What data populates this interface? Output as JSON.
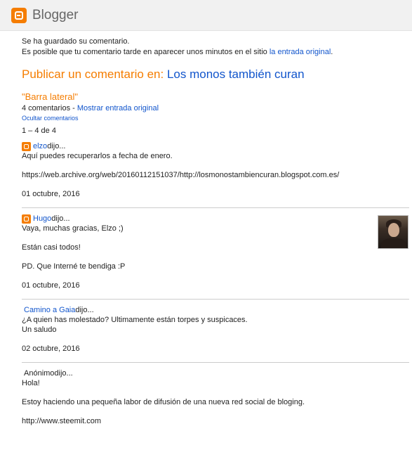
{
  "header": {
    "logo_text": "Blogger"
  },
  "notice": {
    "line1": "Se ha guardado su comentario.",
    "line2_prefix": "Es posible que tu comentario tarde en aparecer unos minutos en el sitio ",
    "line2_link": "la entrada original",
    "line2_suffix": "."
  },
  "publish": {
    "prefix": "Publicar un comentario en: ",
    "blog_name": "Los monos también curan"
  },
  "post": {
    "title": "\"Barra lateral\"",
    "comment_count": "4 comentarios",
    "separator": " - ",
    "show_post_link": "Mostrar entrada original",
    "hide_comments_link": "Ocultar comentarios",
    "range": "1 – 4 de 4"
  },
  "comments": [
    {
      "author": "elzo",
      "said": " dijo...",
      "lines": [
        "Aquí puedes recuperarlos a fecha de enero.",
        "",
        "https://web.archive.org/web/20160112151037/http://losmonostambiencuran.blogspot.com.es/"
      ],
      "date": "01 octubre, 2016"
    },
    {
      "author": "Hugo",
      "said": " dijo...",
      "lines": [
        "Vaya, muchas gracias, Elzo ;)",
        "",
        "Están casi todos!",
        "",
        "PD. Que Interné te bendiga :P"
      ],
      "date": "01 octubre, 2016"
    },
    {
      "author": "Camino a Gaia",
      "said": " dijo...",
      "lines": [
        "¿A quien has molestado? Ultimamente están torpes y suspicaces.",
        "Un saludo"
      ],
      "date": "02 octubre, 2016"
    },
    {
      "author": "Anónimo",
      "said": " dijo...",
      "lines": [
        "Hola!",
        "",
        "Estoy haciendo una pequeña labor de difusión de una nueva red social de bloging.",
        "",
        "http://www.steemit.com"
      ]
    }
  ],
  "colors": {
    "accent": "#f57d00",
    "link": "#1155cc",
    "header_bg": "#f1f1f1"
  }
}
